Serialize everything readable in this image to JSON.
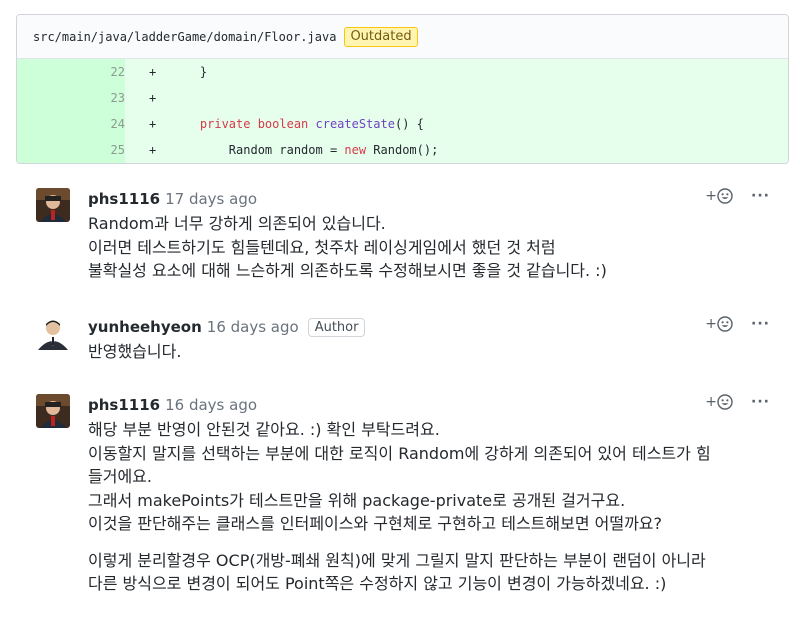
{
  "file": {
    "path": "src/main/java/ladderGame/domain/Floor.java",
    "badge": "Outdated"
  },
  "diff": [
    {
      "num": "22",
      "sign": "+",
      "indent": "    ",
      "parts": [
        {
          "t": "}",
          "c": ""
        }
      ]
    },
    {
      "num": "23",
      "sign": "+",
      "indent": "",
      "parts": []
    },
    {
      "num": "24",
      "sign": "+",
      "indent": "    ",
      "parts": [
        {
          "t": "private boolean ",
          "c": "kw"
        },
        {
          "t": "createState",
          "c": "fn"
        },
        {
          "t": "() {",
          "c": ""
        }
      ]
    },
    {
      "num": "25",
      "sign": "+",
      "indent": "        ",
      "parts": [
        {
          "t": "Random random = ",
          "c": ""
        },
        {
          "t": "new",
          "c": "kw"
        },
        {
          "t": " Random();",
          "c": ""
        }
      ]
    }
  ],
  "comments": [
    {
      "author": "phs1116",
      "time": "17 days ago",
      "badge": "",
      "lines": [
        "Random과 너무 강하게 의존되어 있습니다.",
        "이러면 테스트하기도 힘들텐데요, 첫주차 레이싱게임에서 했던 것 처럼",
        "불확실성 요소에 대해 느슨하게 의존하도록 수정해보시면 좋을 것 같습니다. :)"
      ],
      "para2": []
    },
    {
      "author": "yunheehyeon",
      "time": "16 days ago",
      "badge": "Author",
      "lines": [
        "반영했습니다."
      ],
      "para2": []
    },
    {
      "author": "phs1116",
      "time": "16 days ago",
      "badge": "",
      "lines": [
        "해당 부분 반영이 안된것 같아요. :) 확인 부탁드려요.",
        "이동할지 말지를 선택하는 부분에 대한 로직이 Random에 강하게 의존되어 있어 테스트가 힘",
        "들거에요.",
        "그래서 makePoints가 테스트만을 위해 package-private로 공개된 걸거구요.",
        "이것을 판단해주는 클래스를 인터페이스와 구현체로 구현하고 테스트해보면 어떨까요?"
      ],
      "para2": [
        "이렇게 분리할경우 OCP(개방-폐쇄 원칙)에 맞게 그릴지 말지 판단하는 부분이 랜덤이 아니라",
        "다른 방식으로 변경이 되어도 Point쪽은 수정하지 않고 기능이 변경이 가능하겠네요. :)"
      ]
    }
  ],
  "actions": {
    "reaction_label": "+",
    "more_label": "···",
    "reaction_icon": "smiley-icon"
  },
  "colors": {
    "diff_added_bg": "#e6ffed",
    "diff_added_num_bg": "#cdffd8",
    "outdated_bg": "#fff5b1",
    "keyword": "#d73a49",
    "function": "#6f42c1"
  }
}
